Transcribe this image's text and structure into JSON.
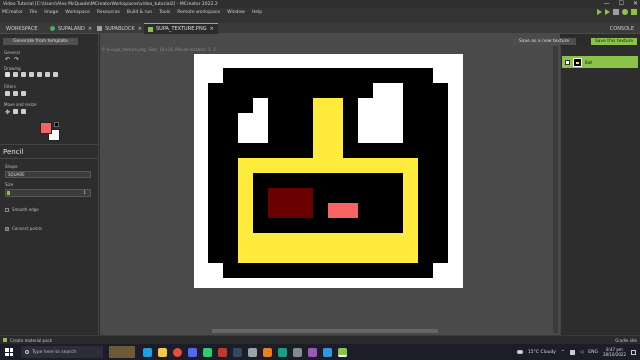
{
  "window": {
    "title": "Video Tutorial [C:\\Users\\Alex McQuade\\MCreatorWorkspaces\\video_tutorial2] - MCreator 2022.2",
    "controls": [
      "—",
      "☐",
      "✕"
    ]
  },
  "menu": {
    "items": [
      "MCreator",
      "File",
      "Image",
      "Workspace",
      "Resources",
      "Build & run",
      "Tools",
      "Remote workspace",
      "Window",
      "Help"
    ]
  },
  "tabs": [
    {
      "label": "WORKSPACE"
    },
    {
      "label": "SUPALAND"
    },
    {
      "label": "SUPABLOCK"
    },
    {
      "label": "SUPA_TEXTURE.PNG"
    }
  ],
  "console_label": "CONSOLE",
  "left": {
    "generate_button": "Generate from template",
    "sections": {
      "general": "General",
      "drawing": "Drawing",
      "filters": "Filters",
      "move": "Move and resize"
    },
    "tool_header": "Pencil",
    "shape_label": "Shape",
    "shape_value": "SQUARE",
    "size_label": "Size",
    "size_value": "1",
    "smooth_edge": "Smooth edge",
    "connect_points": "Connect points"
  },
  "canvas": {
    "info": "0 %  supa_texture.png, Size: 16×16, Mouse location: 3, 3"
  },
  "right": {
    "save_new_label": "Save as a new texture",
    "save_label": "Save this texture",
    "layer_name": "Ball"
  },
  "status": {
    "text": "Create material pack",
    "right_text": "Gradle idle"
  },
  "taskbar": {
    "search_placeholder": "Type here to search",
    "weather": "15°C  Cloudy",
    "lang": "ENG",
    "time": "8:47 pm",
    "date": "28/10/2022"
  },
  "colors": {
    "accent": "#8bc34a",
    "pixel_black": "#000000",
    "pixel_white": "#ffffff",
    "pixel_yellow": "#ffeb3b",
    "pixel_darkred": "#6b0000",
    "pixel_salmon": "#f86464"
  }
}
